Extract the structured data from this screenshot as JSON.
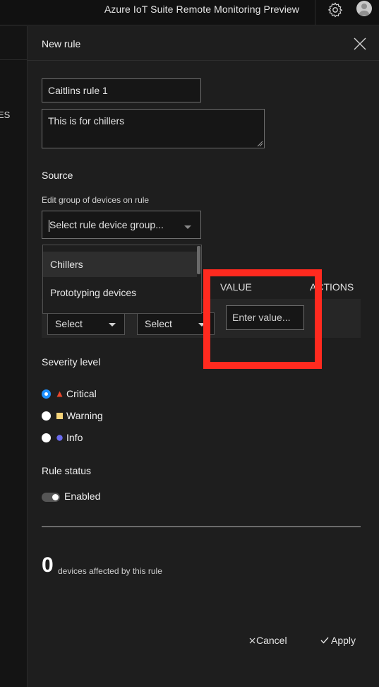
{
  "topbar": {
    "title": "Azure IoT Suite Remote Monitoring Preview",
    "settings_icon": "gear-icon",
    "avatar_icon": "user-avatar-icon"
  },
  "background": {
    "clipped_nav_text": "ES"
  },
  "flyout": {
    "header": "New rule",
    "close_icon": "close-icon",
    "name_value": "Caitlins rule 1",
    "description_value": "This is for chillers",
    "source": {
      "title": "Source",
      "group_label": "Edit group of devices on rule",
      "group_placeholder": "Select rule device group...",
      "options": [
        "Chillers",
        "Prototyping devices"
      ]
    },
    "conditions": {
      "value_header": "VALUE",
      "actions_header": "ACTIONS",
      "field_select": "Select",
      "operator_select": "Select",
      "value_placeholder": "Enter value..."
    },
    "severity": {
      "title": "Severity level",
      "options": [
        {
          "label": "Critical",
          "icon": "triangle-icon",
          "color": "#e8472b",
          "selected": true
        },
        {
          "label": "Warning",
          "icon": "square-icon",
          "color": "#f6d47a",
          "selected": false
        },
        {
          "label": "Info",
          "icon": "circle-icon",
          "color": "#6b6bef",
          "selected": false
        }
      ]
    },
    "status": {
      "title": "Rule status",
      "toggle_label": "Enabled",
      "enabled": true
    },
    "affected": {
      "count": "0",
      "label": "devices affected by this rule"
    },
    "buttons": {
      "cancel": "Cancel",
      "apply": "Apply"
    }
  },
  "colors": {
    "highlight": "#ff2a1f",
    "radio_selected": "#1e90ff"
  }
}
